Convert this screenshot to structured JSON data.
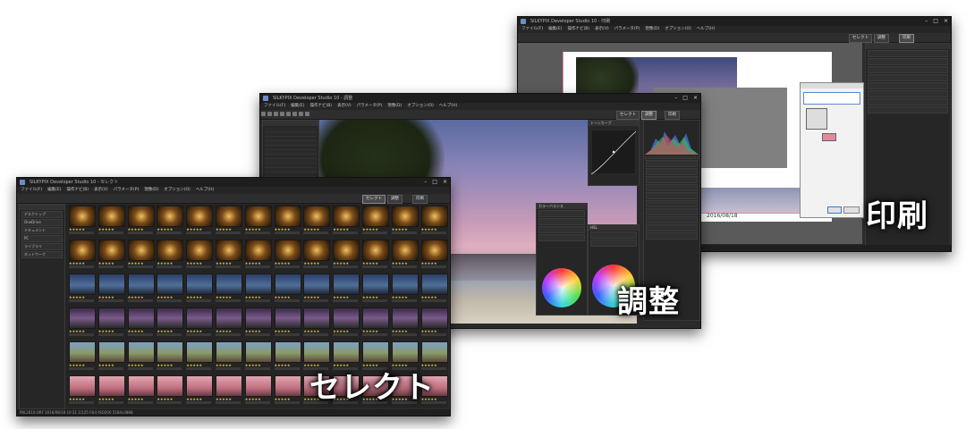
{
  "labels": {
    "print": "印刷",
    "adjust": "調整",
    "select": "セレクト"
  },
  "print_window": {
    "title": "SILKYPIX Developer Studio 10 - 印刷",
    "menu": [
      "ファイル(F)",
      "編集(E)",
      "操作ナビ(B)",
      "表示(V)",
      "パラメータ(P)",
      "現像(D)",
      "オプション(O)",
      "ヘルプ(H)"
    ],
    "tabs": [
      "セレクト",
      "調整",
      "印刷"
    ],
    "date_text": "2016/08/18"
  },
  "adjust_window": {
    "title": "SILKYPIX Developer Studio 10 - 調整",
    "menu": [
      "ファイル(F)",
      "編集(E)",
      "操作ナビ(B)",
      "表示(V)",
      "パラメータ(P)",
      "現像(D)",
      "オプション(O)",
      "ヘルプ(H)"
    ],
    "tabs": [
      "セレクト",
      "調整",
      "印刷"
    ],
    "date_text": "2016/08/18",
    "panel_tone_curve": "トーンカーブ",
    "panel_color_adjust": "カラーバランス",
    "panel_hsl": "HSL"
  },
  "select_window": {
    "title": "SILKYPIX Developer Studio 10 - セレクト",
    "menu": [
      "ファイル(F)",
      "編集(E)",
      "操作ナビ(B)",
      "表示(V)",
      "パラメータ(P)",
      "現像(D)",
      "オプション(O)",
      "ヘルプ(H)"
    ],
    "tabs": [
      "セレクト",
      "調整",
      "印刷"
    ],
    "folder_tree": [
      "デスクトップ",
      "OneDrive",
      "ドキュメント",
      "PC",
      "ライブラリ",
      "ネットワーク"
    ],
    "status": "P8L2610.ORF 2016/08/18 10:31  1/125 F8.0  ISO200  5184x3888"
  },
  "colors": {
    "accent_pink": "#e38a9a",
    "window_bg": "#2b2b2b",
    "star": "#e7c24b"
  }
}
